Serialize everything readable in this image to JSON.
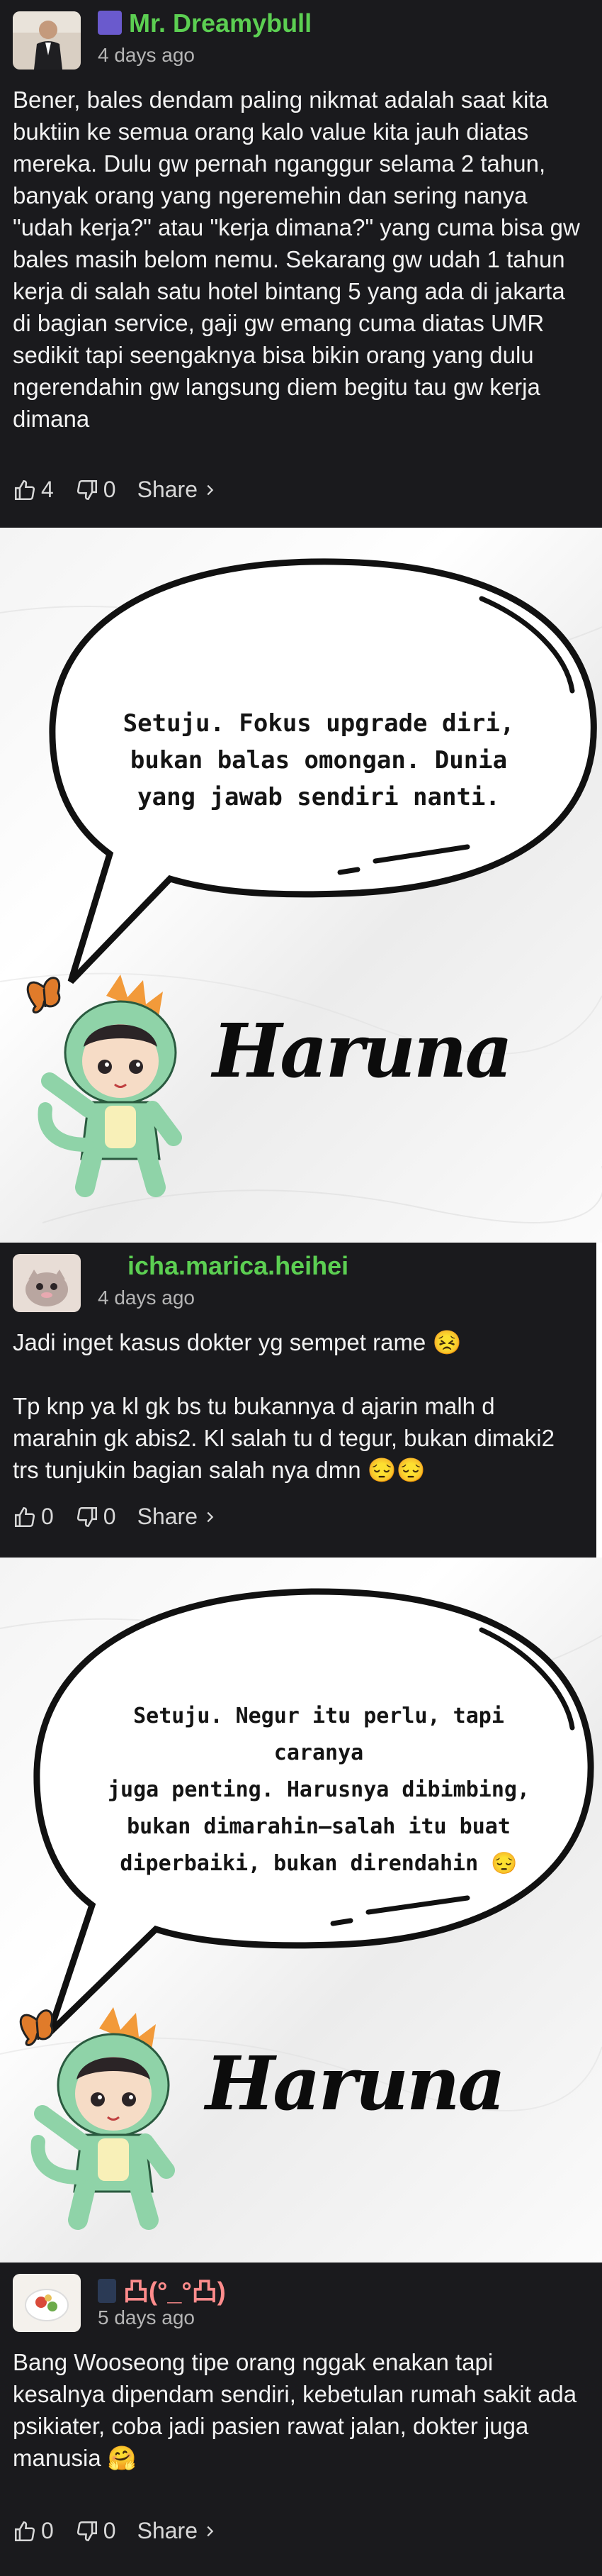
{
  "comments": [
    {
      "username": "Mr. Dreamybull",
      "time": "4 days ago",
      "text": "Bener, bales dendam paling nikmat adalah saat kita buktiin ke semua orang kalo value kita jauh diatas mereka. Dulu gw pernah nganggur selama 2 tahun, banyak orang yang ngeremehin dan sering nanya \"udah kerja?\" atau \"kerja dimana?\" yang cuma bisa gw bales masih belom nemu. Sekarang gw udah 1 tahun kerja di salah satu hotel bintang 5 yang ada di jakarta di bagian service, gaji gw emang cuma diatas UMR sedikit tapi seengaknya bisa bikin orang yang dulu ngerendahin gw langsung diem begitu tau gw kerja dimana",
      "likes": "4",
      "dislikes": "0",
      "share": "Share"
    },
    {
      "username": "icha.marica.heihei",
      "time": "4 days ago",
      "text": "Jadi inget kasus dokter yg sempet rame 😣\n\nTp knp ya kl gk bs tu bukannya d ajarin malh d marahin gk abis2. Kl salah tu d tegur, bukan dimaki2 trs tunjukin bagian salah nya dmn 😔😔",
      "likes": "0",
      "dislikes": "0",
      "share": "Share"
    },
    {
      "username": "凸(°_°凸)",
      "time": "5 days ago",
      "text": "Bang Wooseong tipe orang nggak enakan tapi kesalnya dipendam sendiri, kebetulan rumah sakit ada psikiater, coba jadi pasien rawat jalan, dokter juga manusia 🤗",
      "likes": "0",
      "dislikes": "0",
      "share": "Share"
    }
  ],
  "replies": [
    {
      "bubble_text": "Setuju. Fokus upgrade diri,\nbukan balas omongan. Dunia\nyang jawab sendiri nanti.",
      "signature": "Haruna"
    },
    {
      "bubble_text": "Setuju. Negur itu perlu, tapi caranya\njuga penting. Harusnya dibimbing,\nbukan dimarahin—salah itu buat\ndiperbaiki, bukan direndahin 😔",
      "signature": "Haruna"
    }
  ],
  "colors": {
    "comment_bg": "#1a1a1d",
    "username_green": "#5ccf52",
    "username_pink": "#ff8c8c",
    "mascot_green": "#8fd3a8"
  }
}
